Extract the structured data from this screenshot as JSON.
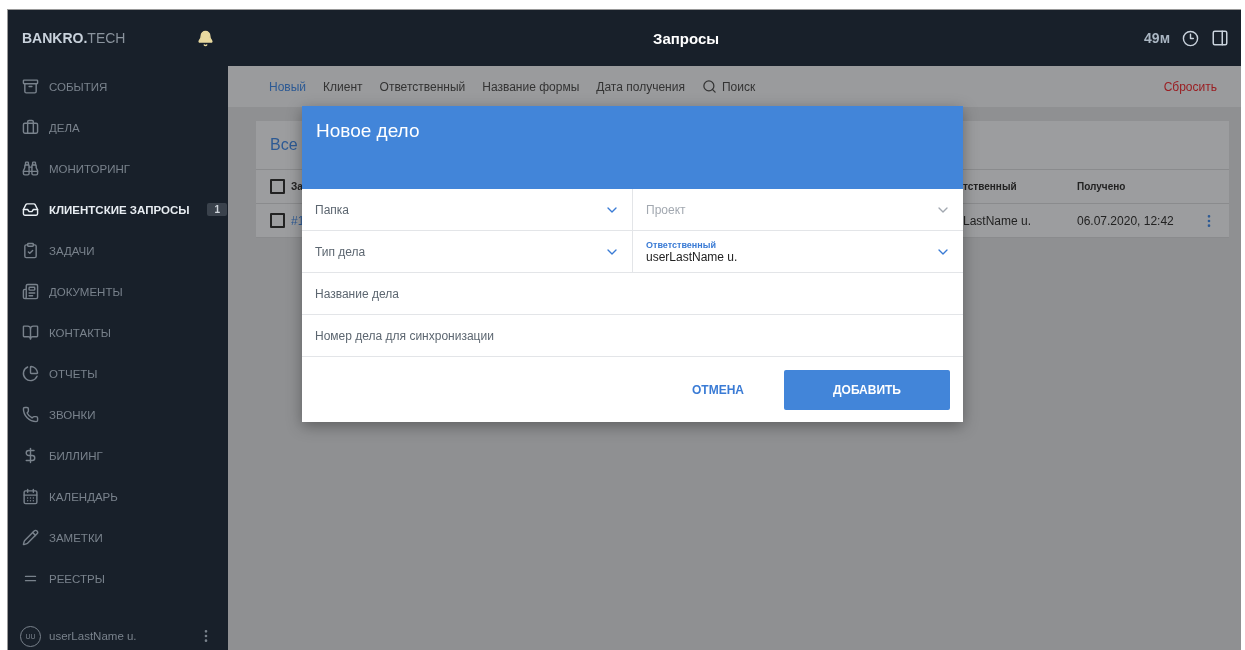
{
  "topbar": {
    "brand_primary": "BANKRO.",
    "brand_secondary": "TECH",
    "title": "Запросы",
    "timer": "49м"
  },
  "sidebar": {
    "items": [
      {
        "label": "СОБЫТИЯ",
        "selected": false
      },
      {
        "label": "ДЕЛА",
        "selected": false
      },
      {
        "label": "МОНИТОРИНГ",
        "selected": false
      },
      {
        "label": "КЛИЕНТСКИЕ ЗАПРОСЫ",
        "selected": true,
        "badge": "1"
      },
      {
        "label": "ЗАДАЧИ",
        "selected": false
      },
      {
        "label": "ДОКУМЕНТЫ",
        "selected": false
      },
      {
        "label": "КОНТАКТЫ",
        "selected": false
      },
      {
        "label": "ОТЧЕТЫ",
        "selected": false
      },
      {
        "label": "ЗВОНКИ",
        "selected": false
      },
      {
        "label": "БИЛЛИНГ",
        "selected": false
      },
      {
        "label": "КАЛЕНДАРЬ",
        "selected": false
      },
      {
        "label": "ЗАМЕТКИ",
        "selected": false
      },
      {
        "label": "РЕЕСТРЫ",
        "selected": false
      }
    ],
    "user": {
      "initials": "UU",
      "name": "userLastName u."
    }
  },
  "filters": {
    "items": [
      {
        "label": "Новый",
        "selected": true
      },
      {
        "label": "Клиент",
        "selected": false
      },
      {
        "label": "Ответственный",
        "selected": false
      },
      {
        "label": "Название формы",
        "selected": false
      },
      {
        "label": "Дата получения",
        "selected": false
      }
    ],
    "search": "Поиск",
    "reset": "Сбросить"
  },
  "card": {
    "title": "Все",
    "columns": [
      {
        "label": "За"
      },
      {
        "label": "тственный"
      },
      {
        "label": "Получено"
      }
    ],
    "rows": [
      {
        "checked": false,
        "cells": [
          "#1",
          "LastName u.",
          "06.07.2020, 12:42"
        ]
      }
    ],
    "header_checked": false
  },
  "dialog": {
    "title": "Новое дело",
    "rows": [
      {
        "fields": [
          {
            "kind": "select",
            "placeholder": "Папка",
            "disabled": false
          },
          {
            "kind": "select",
            "placeholder": "Проект",
            "disabled": true
          }
        ]
      },
      {
        "fields": [
          {
            "kind": "select",
            "placeholder": "Тип дела",
            "disabled": false
          },
          {
            "kind": "select",
            "label": "Ответственный",
            "value": "userLastName u.",
            "disabled": false
          }
        ]
      },
      {
        "fields": [
          {
            "kind": "text",
            "placeholder": "Название дела"
          }
        ]
      },
      {
        "fields": [
          {
            "kind": "text",
            "placeholder": "Номер дела для синхронизации"
          }
        ]
      }
    ],
    "cancel": "ОТМЕНА",
    "submit": "ДОБАВИТЬ"
  }
}
